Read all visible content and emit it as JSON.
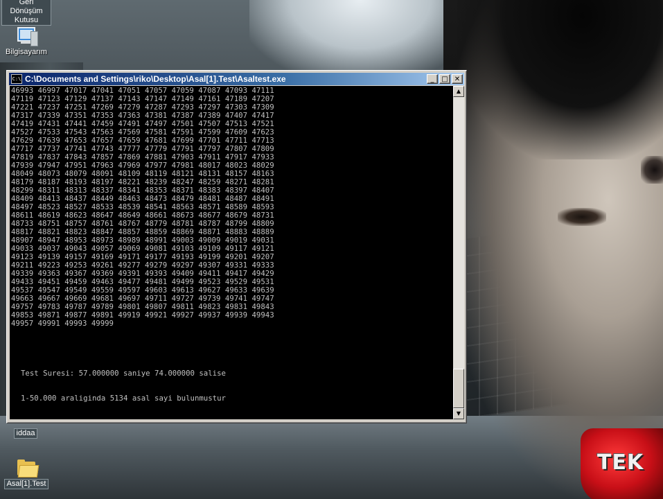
{
  "desktop": {
    "icons": [
      {
        "label": "Geri Dönüşüm\nKutusu",
        "icon": "recycle-bin-icon"
      },
      {
        "label": "Bilgisayarım",
        "icon": "my-computer-icon"
      },
      {
        "label": "iddaa",
        "icon": "iddaa-shortcut-icon"
      },
      {
        "label": "Asal[1].Test",
        "icon": "folder-icon"
      }
    ],
    "wallpaper_logo_text": "TEK"
  },
  "window": {
    "title": "C:\\Documents and Settings\\riko\\Desktop\\Asal[1].Test\\Asaltest.exe",
    "title_icon_text": "C:\\",
    "buttons": {
      "minimize": "_",
      "maximize": "□",
      "close": "✕"
    },
    "console_rows": [
      "46993 46997 47017 47041 47051 47057 47059 47087 47093 47111",
      "47119 47123 47129 47137 47143 47147 47149 47161 47189 47207",
      "47221 47237 47251 47269 47279 47287 47293 47297 47303 47309",
      "47317 47339 47351 47353 47363 47381 47387 47389 47407 47417",
      "47419 47431 47441 47459 47491 47497 47501 47507 47513 47521",
      "47527 47533 47543 47563 47569 47581 47591 47599 47609 47623",
      "47629 47639 47653 47657 47659 47681 47699 47701 47711 47713",
      "47717 47737 47741 47743 47777 47779 47791 47797 47807 47809",
      "47819 47837 47843 47857 47869 47881 47903 47911 47917 47933",
      "47939 47947 47951 47963 47969 47977 47981 48017 48023 48029",
      "48049 48073 48079 48091 48109 48119 48121 48131 48157 48163",
      "48179 48187 48193 48197 48221 48239 48247 48259 48271 48281",
      "48299 48311 48313 48337 48341 48353 48371 48383 48397 48407",
      "48409 48413 48437 48449 48463 48473 48479 48481 48487 48491",
      "48497 48523 48527 48533 48539 48541 48563 48571 48589 48593",
      "48611 48619 48623 48647 48649 48661 48673 48677 48679 48731",
      "48733 48751 48757 48761 48767 48779 48781 48787 48799 48809",
      "48817 48821 48823 48847 48857 48859 48869 48871 48883 48889",
      "48907 48947 48953 48973 48989 48991 49003 49009 49019 49031",
      "49033 49037 49043 49057 49069 49081 49103 49109 49117 49121",
      "49123 49139 49157 49169 49171 49177 49193 49199 49201 49207",
      "49211 49223 49253 49261 49277 49279 49297 49307 49331 49333",
      "49339 49363 49367 49369 49391 49393 49409 49411 49417 49429",
      "49433 49451 49459 49463 49477 49481 49499 49523 49529 49531",
      "49537 49547 49549 49559 49597 49603 49613 49627 49633 49639",
      "49663 49667 49669 49681 49697 49711 49727 49739 49741 49747",
      "49757 49783 49787 49789 49801 49807 49811 49823 49831 49843",
      "49853 49871 49877 49891 49919 49921 49927 49937 49939 49943",
      "49957 49991 49993 49999"
    ],
    "test_time_message": "Test Suresi: 57.000000 saniye 74.000000 salise",
    "result_message": "1-50.000 araliginda 5134 asal sayi bulunmustur"
  }
}
